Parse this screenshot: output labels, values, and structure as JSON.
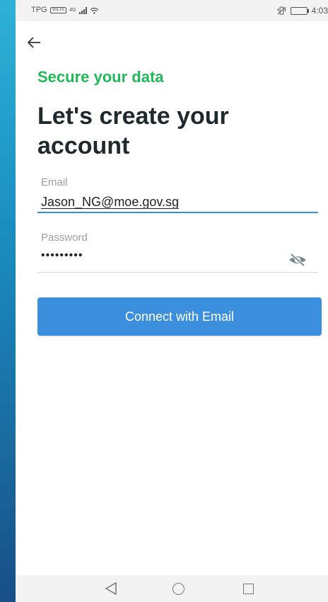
{
  "status_bar": {
    "carrier": "TPG",
    "network_badge": "VoLTE",
    "network_type": "4G",
    "time": "4:03",
    "icons": [
      "signal-icon",
      "wifi-icon",
      "vibrate-icon",
      "battery-icon"
    ]
  },
  "header": {
    "back_icon": "back-arrow-icon"
  },
  "content": {
    "subtitle": "Secure your data",
    "title": "Let's create your account",
    "email": {
      "label": "Email",
      "value": "Jason_NG@moe.gov.sg"
    },
    "password": {
      "label": "Password",
      "value": "•••••••••",
      "toggle_icon": "eye-off-icon"
    },
    "connect_button_label": "Connect with Email"
  },
  "nav_bar": {
    "icons": [
      "nav-back-icon",
      "nav-home-icon",
      "nav-recents-icon"
    ]
  },
  "colors": {
    "accent_green": "#22b85a",
    "primary_blue": "#3b8fdc",
    "title_text": "#1f2a2e",
    "field_label": "#9e9e9e"
  }
}
